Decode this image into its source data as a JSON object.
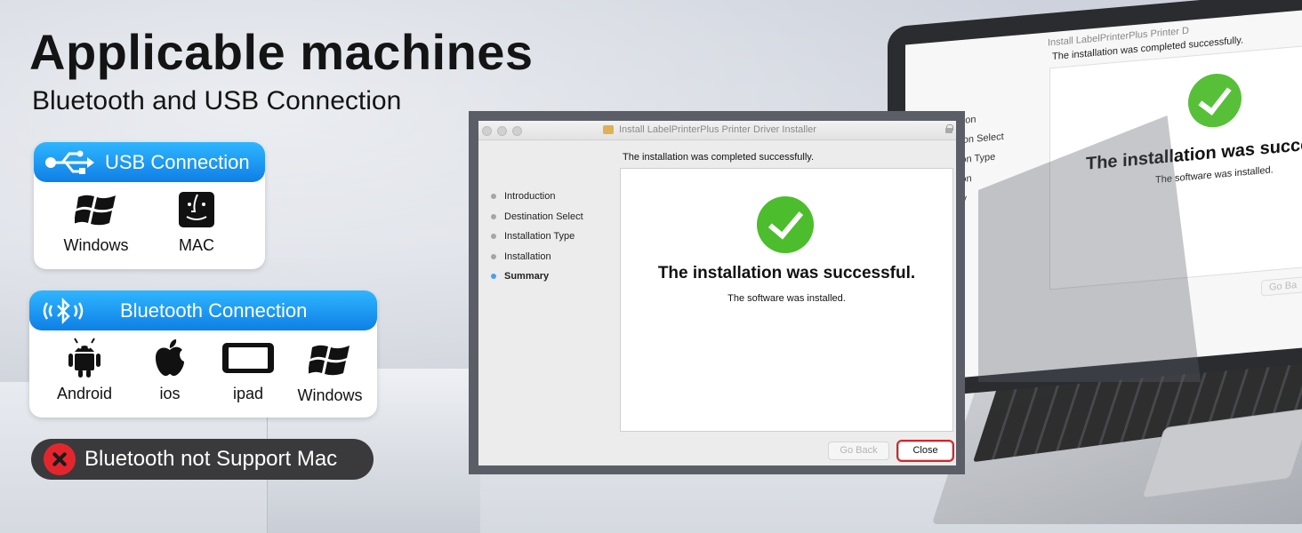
{
  "headline": "Applicable machines",
  "subheadline": "Bluetooth and USB Connection",
  "usb_card": {
    "title": "USB Connection",
    "devices": [
      {
        "label": "Windows",
        "icon": "windows-icon"
      },
      {
        "label": "MAC",
        "icon": "finder-icon"
      }
    ]
  },
  "bluetooth_card": {
    "title": "Bluetooth Connection",
    "devices": [
      {
        "label": "Android",
        "icon": "android-icon"
      },
      {
        "label": "ios",
        "icon": "apple-icon"
      },
      {
        "label": "ipad",
        "icon": "tablet-icon"
      },
      {
        "label": "Windows",
        "icon": "windows-icon"
      }
    ]
  },
  "warning": {
    "text": "Bluetooth not Support Mac",
    "icon": "close-x-icon",
    "color": "#e3262e"
  },
  "installer": {
    "window_title": "Install LabelPrinterPlus Printer Driver Installer",
    "status_message": "The installation was completed successfully.",
    "steps": [
      {
        "label": "Introduction",
        "active": false
      },
      {
        "label": "Destination Select",
        "active": false
      },
      {
        "label": "Installation Type",
        "active": false
      },
      {
        "label": "Installation",
        "active": false
      },
      {
        "label": "Summary",
        "active": true
      }
    ],
    "success_title": "The installation was successful.",
    "success_subtitle": "The software was installed.",
    "go_back_label": "Go Back",
    "close_label": "Close"
  },
  "laptop_screen": {
    "window_title": "Install LabelPrinterPlus Printer D",
    "status_message": "The installation was completed successfully.",
    "steps": [
      "Introduction",
      "Destination Select",
      "Installation Type",
      "Installation",
      "Summary"
    ],
    "success_title": "The installation was succes",
    "success_subtitle": "The software was installed.",
    "go_back_label": "Go Ba"
  },
  "colors": {
    "accent_blue": "#0e7fe6",
    "success_green": "#4cbd2c",
    "close_highlight": "#d6242b"
  }
}
